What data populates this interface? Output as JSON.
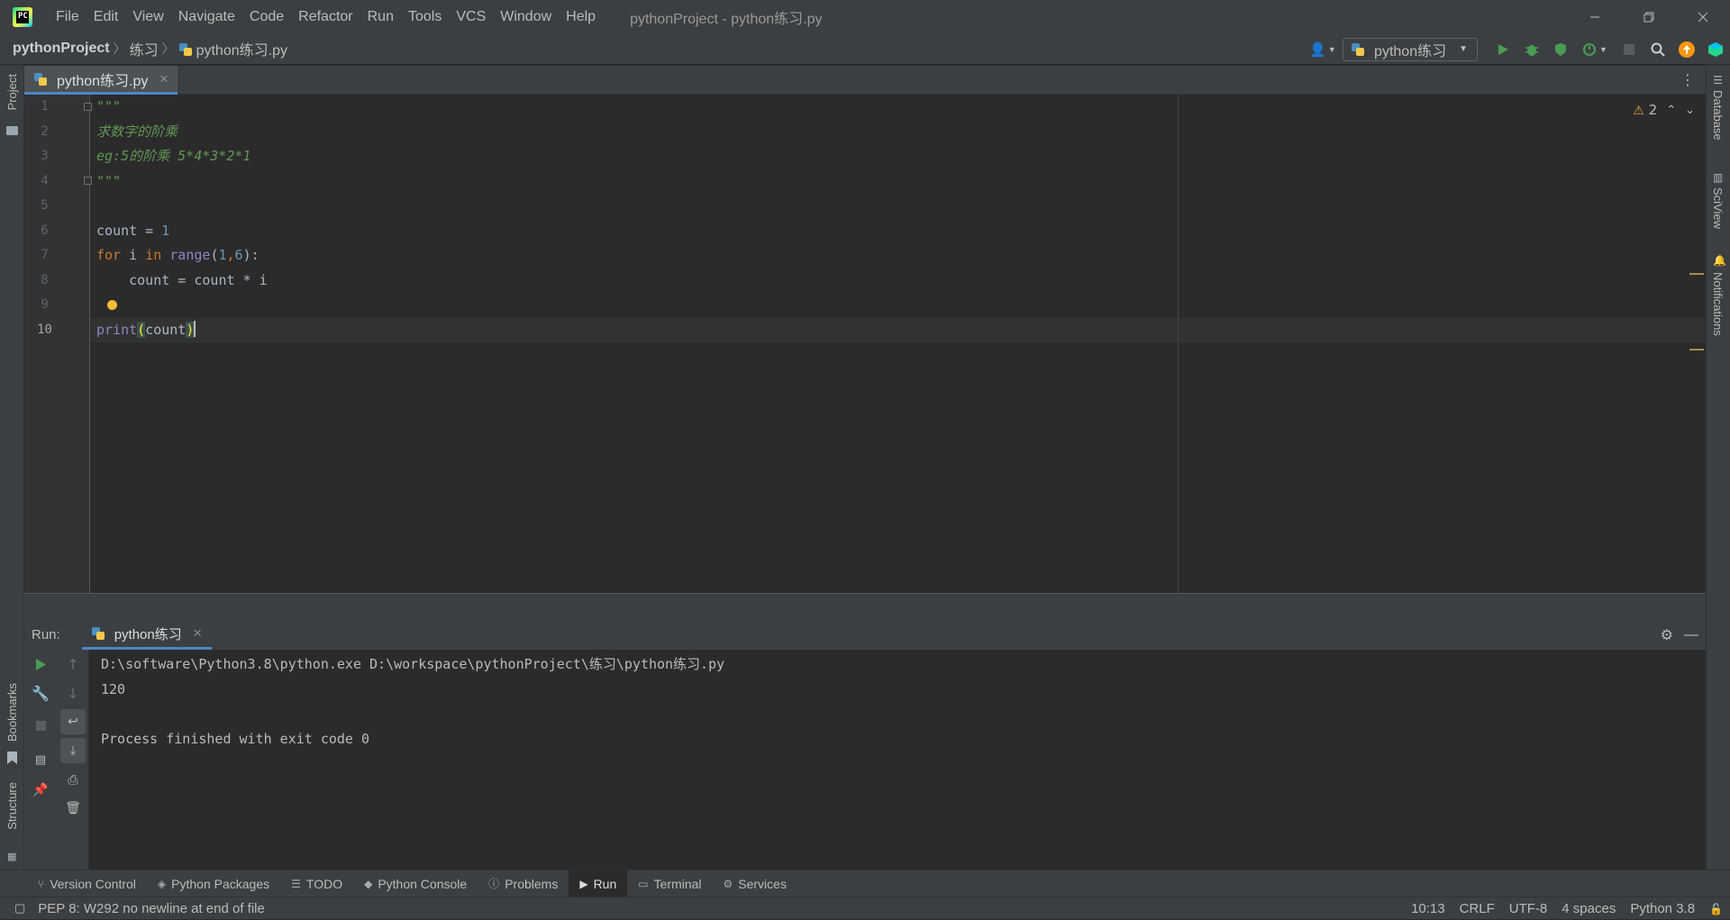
{
  "menu": {
    "items": [
      "File",
      "Edit",
      "View",
      "Navigate",
      "Code",
      "Refactor",
      "Run",
      "Tools",
      "VCS",
      "Window",
      "Help"
    ],
    "window_title": "pythonProject - python练习.py"
  },
  "breadcrumb": {
    "project": "pythonProject",
    "folder": "练习",
    "file": "python练习.py"
  },
  "run_config": {
    "label": "python练习"
  },
  "editor": {
    "tab_label": "python练习.py",
    "warning_count": "2",
    "lines": [
      "1",
      "2",
      "3",
      "4",
      "5",
      "6",
      "7",
      "8",
      "9",
      "10"
    ],
    "code": {
      "l1": "\"\"\"",
      "l2": "求数字的阶乘",
      "l3": "eg:5的阶乘 5*4*3*2*1",
      "l4": "\"\"\"",
      "l6_var": "count",
      "l6_op": " = ",
      "l6_num": "1",
      "l7_for": "for",
      "l7_i": " i ",
      "l7_in": "in",
      "l7_range": " range",
      "l7_open": "(",
      "l7_a": "1",
      "l7_comma": ",",
      "l7_b": "6",
      "l7_close": "):",
      "l8": "    count = count * i",
      "l10_fn": "print",
      "l10_open": "(",
      "l10_arg": "count",
      "l10_close": ")"
    }
  },
  "side_panels": {
    "left_top": "Project",
    "left_bookmarks": "Bookmarks",
    "left_structure": "Structure",
    "right_database": "Database",
    "right_sciview": "SciView",
    "right_notifications": "Notifications"
  },
  "run_panel": {
    "label": "Run:",
    "tab": "python练习",
    "output": [
      "D:\\software\\Python3.8\\python.exe D:\\workspace\\pythonProject\\练习\\python练习.py",
      "120",
      "",
      "Process finished with exit code 0"
    ]
  },
  "tool_windows": [
    "Version Control",
    "Python Packages",
    "TODO",
    "Python Console",
    "Problems",
    "Run",
    "Terminal",
    "Services"
  ],
  "status": {
    "message": "PEP 8: W292 no newline at end of file",
    "position": "10:13",
    "line_sep": "CRLF",
    "encoding": "UTF-8",
    "indent": "4 spaces",
    "interpreter": "Python 3.8"
  },
  "colors": {
    "background": "#2b2b2b",
    "panel": "#3c3f41",
    "accent": "#4a88c7",
    "run_green": "#499c54"
  }
}
